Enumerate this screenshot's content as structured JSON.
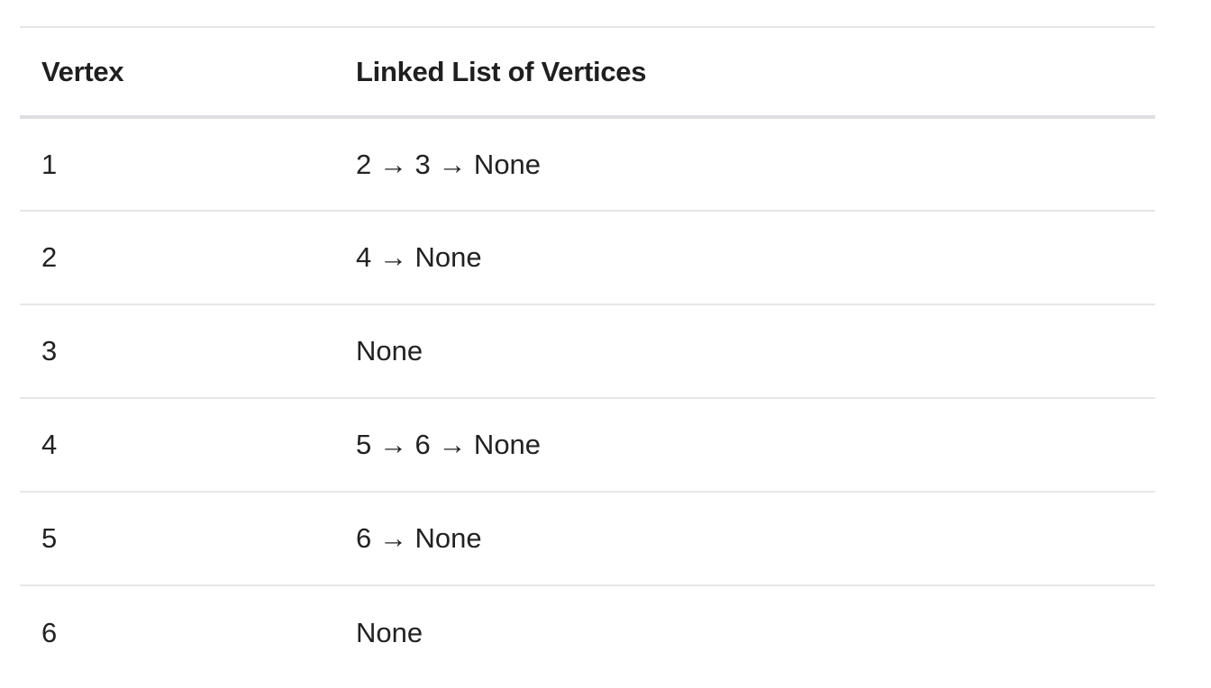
{
  "table": {
    "headers": {
      "vertex": "Vertex",
      "linked_list": "Linked List of Vertices"
    },
    "rows": [
      {
        "vertex": "1",
        "list": "2 → 3 → None"
      },
      {
        "vertex": "2",
        "list": "4 → None"
      },
      {
        "vertex": "3",
        "list": "None"
      },
      {
        "vertex": "4",
        "list": "5 → 6 → None"
      },
      {
        "vertex": "5",
        "list": "6 → None"
      },
      {
        "vertex": "6",
        "list": "None"
      }
    ]
  },
  "colors": {
    "text": "#222222",
    "header_text": "#1f1f1f",
    "row_border": "#e6e6e6",
    "header_border": "#dedde5",
    "background": "#ffffff"
  }
}
